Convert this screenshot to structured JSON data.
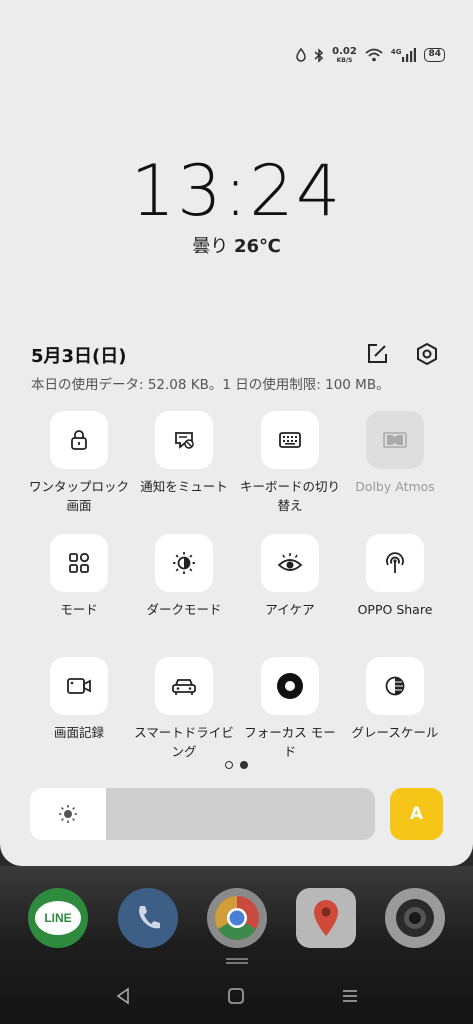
{
  "status": {
    "speed_value": "0.02",
    "speed_unit": "KB/S",
    "network": "4G",
    "battery": "84"
  },
  "clock": {
    "time": "13:24",
    "weather_condition": "曇り",
    "temperature": "26℃"
  },
  "header": {
    "date": "5月3日(日)",
    "usage": "本日の使用データ: 52.08 KB。1 日の使用制限: 100 MB。"
  },
  "tiles": [
    {
      "label": "ワンタップロック画面",
      "icon": "lock-icon",
      "enabled": true
    },
    {
      "label": "通知をミュート",
      "icon": "mute-notification-icon",
      "enabled": true
    },
    {
      "label": "キーボードの切り替え",
      "icon": "keyboard-icon",
      "enabled": true
    },
    {
      "label": "Dolby Atmos",
      "icon": "dolby-icon",
      "enabled": false
    },
    {
      "label": "モード",
      "icon": "grid-icon",
      "enabled": true
    },
    {
      "label": "ダークモード",
      "icon": "dark-mode-icon",
      "enabled": true
    },
    {
      "label": "アイケア",
      "icon": "eye-icon",
      "enabled": true
    },
    {
      "label": "OPPO Share",
      "icon": "share-icon",
      "enabled": true
    },
    {
      "label": "画面記録",
      "icon": "video-icon",
      "enabled": true
    },
    {
      "label": "スマートドライビング",
      "icon": "car-icon",
      "enabled": true
    },
    {
      "label": "フォーカス モード",
      "icon": "focus-icon",
      "enabled": true
    },
    {
      "label": "グレースケール",
      "icon": "grayscale-icon",
      "enabled": true
    }
  ],
  "pager": {
    "pages": 2,
    "current": 2
  },
  "brightness": {
    "level": 0.22,
    "auto_label": "A",
    "accent": "#f5c518"
  },
  "dock": {
    "apps": [
      "LINE",
      "Phone",
      "Chrome",
      "Maps",
      "Camera"
    ],
    "line_label": "LINE"
  },
  "colors": {
    "panel": "#ececec",
    "tile": "#ffffff",
    "disabled_tile": "#dedede"
  }
}
